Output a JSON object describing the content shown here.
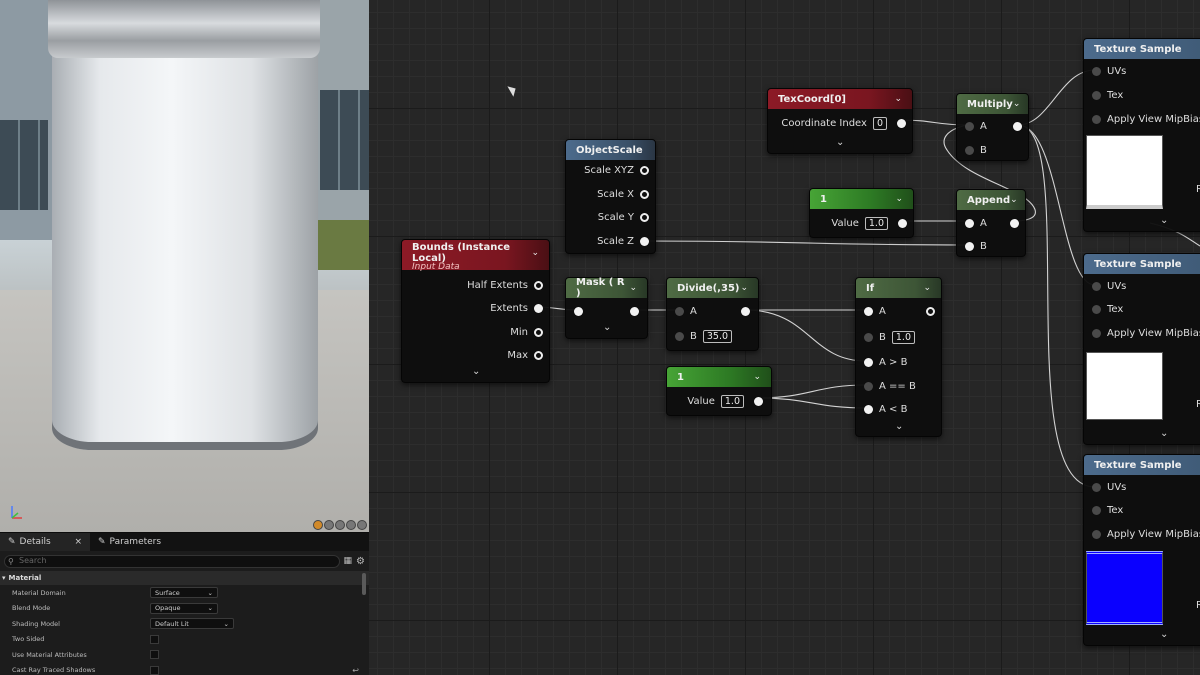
{
  "details": {
    "tabs": [
      {
        "label": "Details",
        "close": "×"
      },
      {
        "label": "Parameters"
      }
    ],
    "search_placeholder": "Search",
    "section": "Material",
    "props": [
      {
        "label": "Material Domain",
        "value": "Surface",
        "type": "dropdown"
      },
      {
        "label": "Blend Mode",
        "value": "Opaque",
        "type": "dropdown"
      },
      {
        "label": "Shading Model",
        "value": "Default Lit",
        "type": "dropdown"
      },
      {
        "label": "Two Sided",
        "type": "checkbox"
      },
      {
        "label": "Use Material Attributes",
        "type": "checkbox"
      },
      {
        "label": "Cast Ray Traced Shadows",
        "type": "checkbox"
      }
    ],
    "reset_glyph": "↩"
  },
  "nodes": {
    "objectscale": {
      "title": "ObjectScale",
      "pins": [
        "Scale XYZ",
        "Scale X",
        "Scale Y",
        "Scale Z"
      ]
    },
    "bounds": {
      "title": "Bounds (Instance Local)",
      "subtitle": "Input Data",
      "pins": [
        "Half Extents",
        "Extents",
        "Min",
        "Max"
      ]
    },
    "texcoord": {
      "title": "TexCoord[0]",
      "pin": "Coordinate Index",
      "value": "0"
    },
    "multiply": {
      "title": "Multiply",
      "a": "A",
      "b": "B"
    },
    "const1": {
      "title": "1",
      "pin": "Value",
      "value": "1.0"
    },
    "append": {
      "title": "Append",
      "a": "A",
      "b": "B"
    },
    "mask": {
      "title": "Mask ( R )"
    },
    "divide": {
      "title": "Divide(,35)",
      "a": "A",
      "b": "B",
      "b_value": "35.0"
    },
    "const2": {
      "title": "1",
      "pin": "Value",
      "value": "1.0"
    },
    "if": {
      "title": "If",
      "a": "A",
      "b": "B",
      "b_value": "1.0",
      "agb": "A > B",
      "aeb": "A == B",
      "alb": "A < B"
    },
    "tex": [
      {
        "title": "Texture Sample",
        "uvs": "UVs",
        "tex": "Tex",
        "mip": "Apply View MipBias",
        "r": "R",
        "preview": "#ffffff"
      },
      {
        "title": "Texture Sample",
        "uvs": "UVs",
        "tex": "Tex",
        "mip": "Apply View MipBias",
        "r": "R",
        "preview": "#ffffff"
      },
      {
        "title": "Texture Sample",
        "uvs": "UVs",
        "tex": "Tex",
        "mip": "Apply View MipBias",
        "r": "R",
        "preview": "#0a00ff"
      }
    ]
  },
  "colors": {
    "header_blue": "#4c6b8c",
    "header_red": "#8c1a26",
    "header_green": "#4f6b44",
    "header_brightgreen": "#47a436"
  }
}
